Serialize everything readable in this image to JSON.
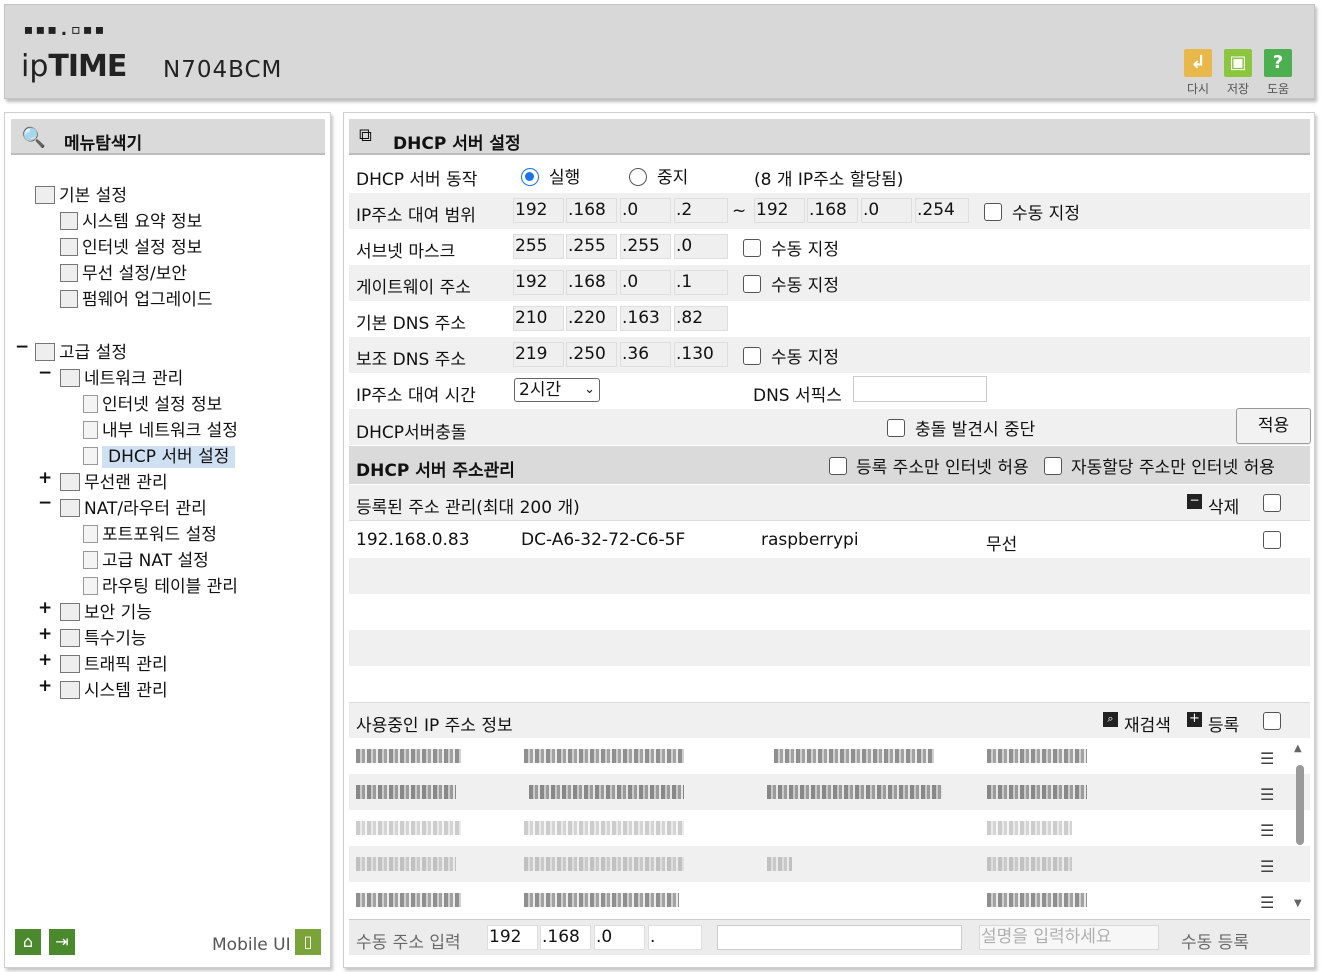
{
  "header": {
    "logo_dots": "▪▪▪.▫▪▪",
    "brand_prefix": "ip",
    "brand_strong": "TIME",
    "model": "N704BCM",
    "buttons": [
      {
        "label": "다시",
        "icon": "undo-icon",
        "color": "#e8b84a"
      },
      {
        "label": "저장",
        "icon": "save-icon",
        "color": "#8cc63f"
      },
      {
        "label": "도움",
        "icon": "help-icon",
        "color": "#4caf50"
      }
    ]
  },
  "sidebar": {
    "title": "메뉴탐색기",
    "basic": {
      "label": "기본 설정",
      "items": [
        "시스템 요약 정보",
        "인터넷 설정 정보",
        "무선 설정/보안",
        "펌웨어 업그레이드"
      ]
    },
    "advanced": {
      "label": "고급 설정",
      "network": {
        "label": "네트워크 관리",
        "items": [
          "인터넷 설정 정보",
          "내부 네트워크 설정",
          "DHCP 서버 설정"
        ]
      },
      "wireless": "무선랜 관리",
      "nat": {
        "label": "NAT/라우터 관리",
        "items": [
          "포트포워드 설정",
          "고급 NAT 설정",
          "라우팅 테이블 관리"
        ]
      },
      "security": "보안 기능",
      "special": "특수기능",
      "traffic": "트래픽 관리",
      "system": "시스템 관리"
    },
    "toggles": {
      "collapse": "−",
      "expand": "+"
    },
    "mobile_label": "Mobile UI"
  },
  "main": {
    "title": "DHCP 서버 설정",
    "server_action": {
      "label": "DHCP 서버 동작",
      "run": "실행",
      "stop": "중지",
      "selected": "run",
      "note": "(8 개 IP주소 할당됨)"
    },
    "lease_range": {
      "label": "IP주소 대여 범위",
      "start": [
        "192",
        ".168",
        ".0",
        ".2"
      ],
      "sep": "~",
      "end": [
        "192",
        ".168",
        ".0",
        ".254"
      ],
      "manual": "수동 지정"
    },
    "subnet": {
      "label": "서브넷 마스크",
      "value": [
        "255",
        ".255",
        ".255",
        ".0"
      ],
      "manual": "수동 지정"
    },
    "gateway": {
      "label": "게이트웨이 주소",
      "value": [
        "192",
        ".168",
        ".0",
        ".1"
      ],
      "manual": "수동 지정"
    },
    "dns1": {
      "label": "기본 DNS 주소",
      "value": [
        "210",
        ".220",
        ".163",
        ".82"
      ]
    },
    "dns2": {
      "label": "보조 DNS 주소",
      "value": [
        "219",
        ".250",
        ".36",
        ".130"
      ],
      "manual": "수동 지정"
    },
    "lease_time": {
      "label": "IP주소 대여 시간",
      "value": "2시간",
      "dns_suffix_label": "DNS 서픽스",
      "dns_suffix_value": ""
    },
    "conflict": {
      "label": "DHCP서버충돌",
      "option": "충돌 발견시 중단"
    },
    "apply_label": "적용",
    "address_mgmt": {
      "title": "DHCP 서버 주소관리",
      "opt_registered": "등록 주소만 인터넷 허용",
      "opt_auto": "자동할당 주소만 인터넷 허용"
    },
    "registered": {
      "title": "등록된 주소 관리(최대 200 개)",
      "delete_label": "삭제",
      "rows": [
        {
          "ip": "192.168.0.83",
          "mac": "DC-A6-32-72-C6-5F",
          "name": "raspberrypi",
          "type": "무선"
        }
      ]
    },
    "in_use": {
      "title": "사용중인 IP 주소 정보",
      "rescan_label": "재검색",
      "register_label": "등록"
    },
    "manual_reg": {
      "label": "수동 주소 입력",
      "ip": [
        "192",
        ".168",
        ".0",
        "."
      ],
      "desc_placeholder": "설명을 입력하세요",
      "button": "수동 등록"
    }
  }
}
